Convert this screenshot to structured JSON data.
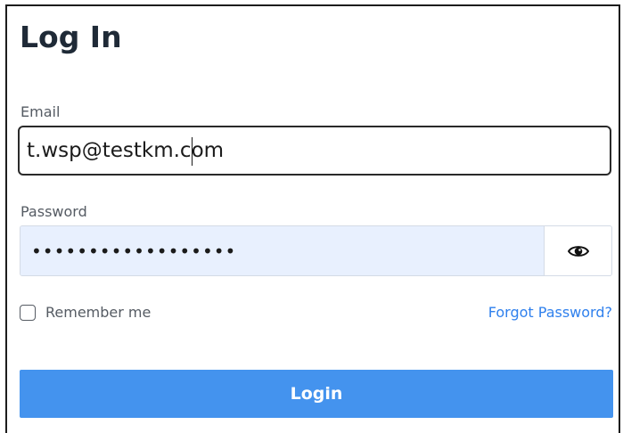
{
  "form": {
    "title": "Log In",
    "email_label": "Email",
    "email_value": "t.wsp@testkm.com",
    "password_label": "Password",
    "password_value": "••••••••••••••••••",
    "password_toggle_icon": "eye-icon",
    "remember_label": "Remember me",
    "remember_checked": false,
    "forgot_link": "Forgot Password?",
    "login_button": "Login"
  },
  "colors": {
    "primary": "#4493ee",
    "link": "#2f80ed",
    "autofill_background": "#e8f0fe",
    "title_text": "#1f2a37",
    "label_text": "#555b63"
  }
}
